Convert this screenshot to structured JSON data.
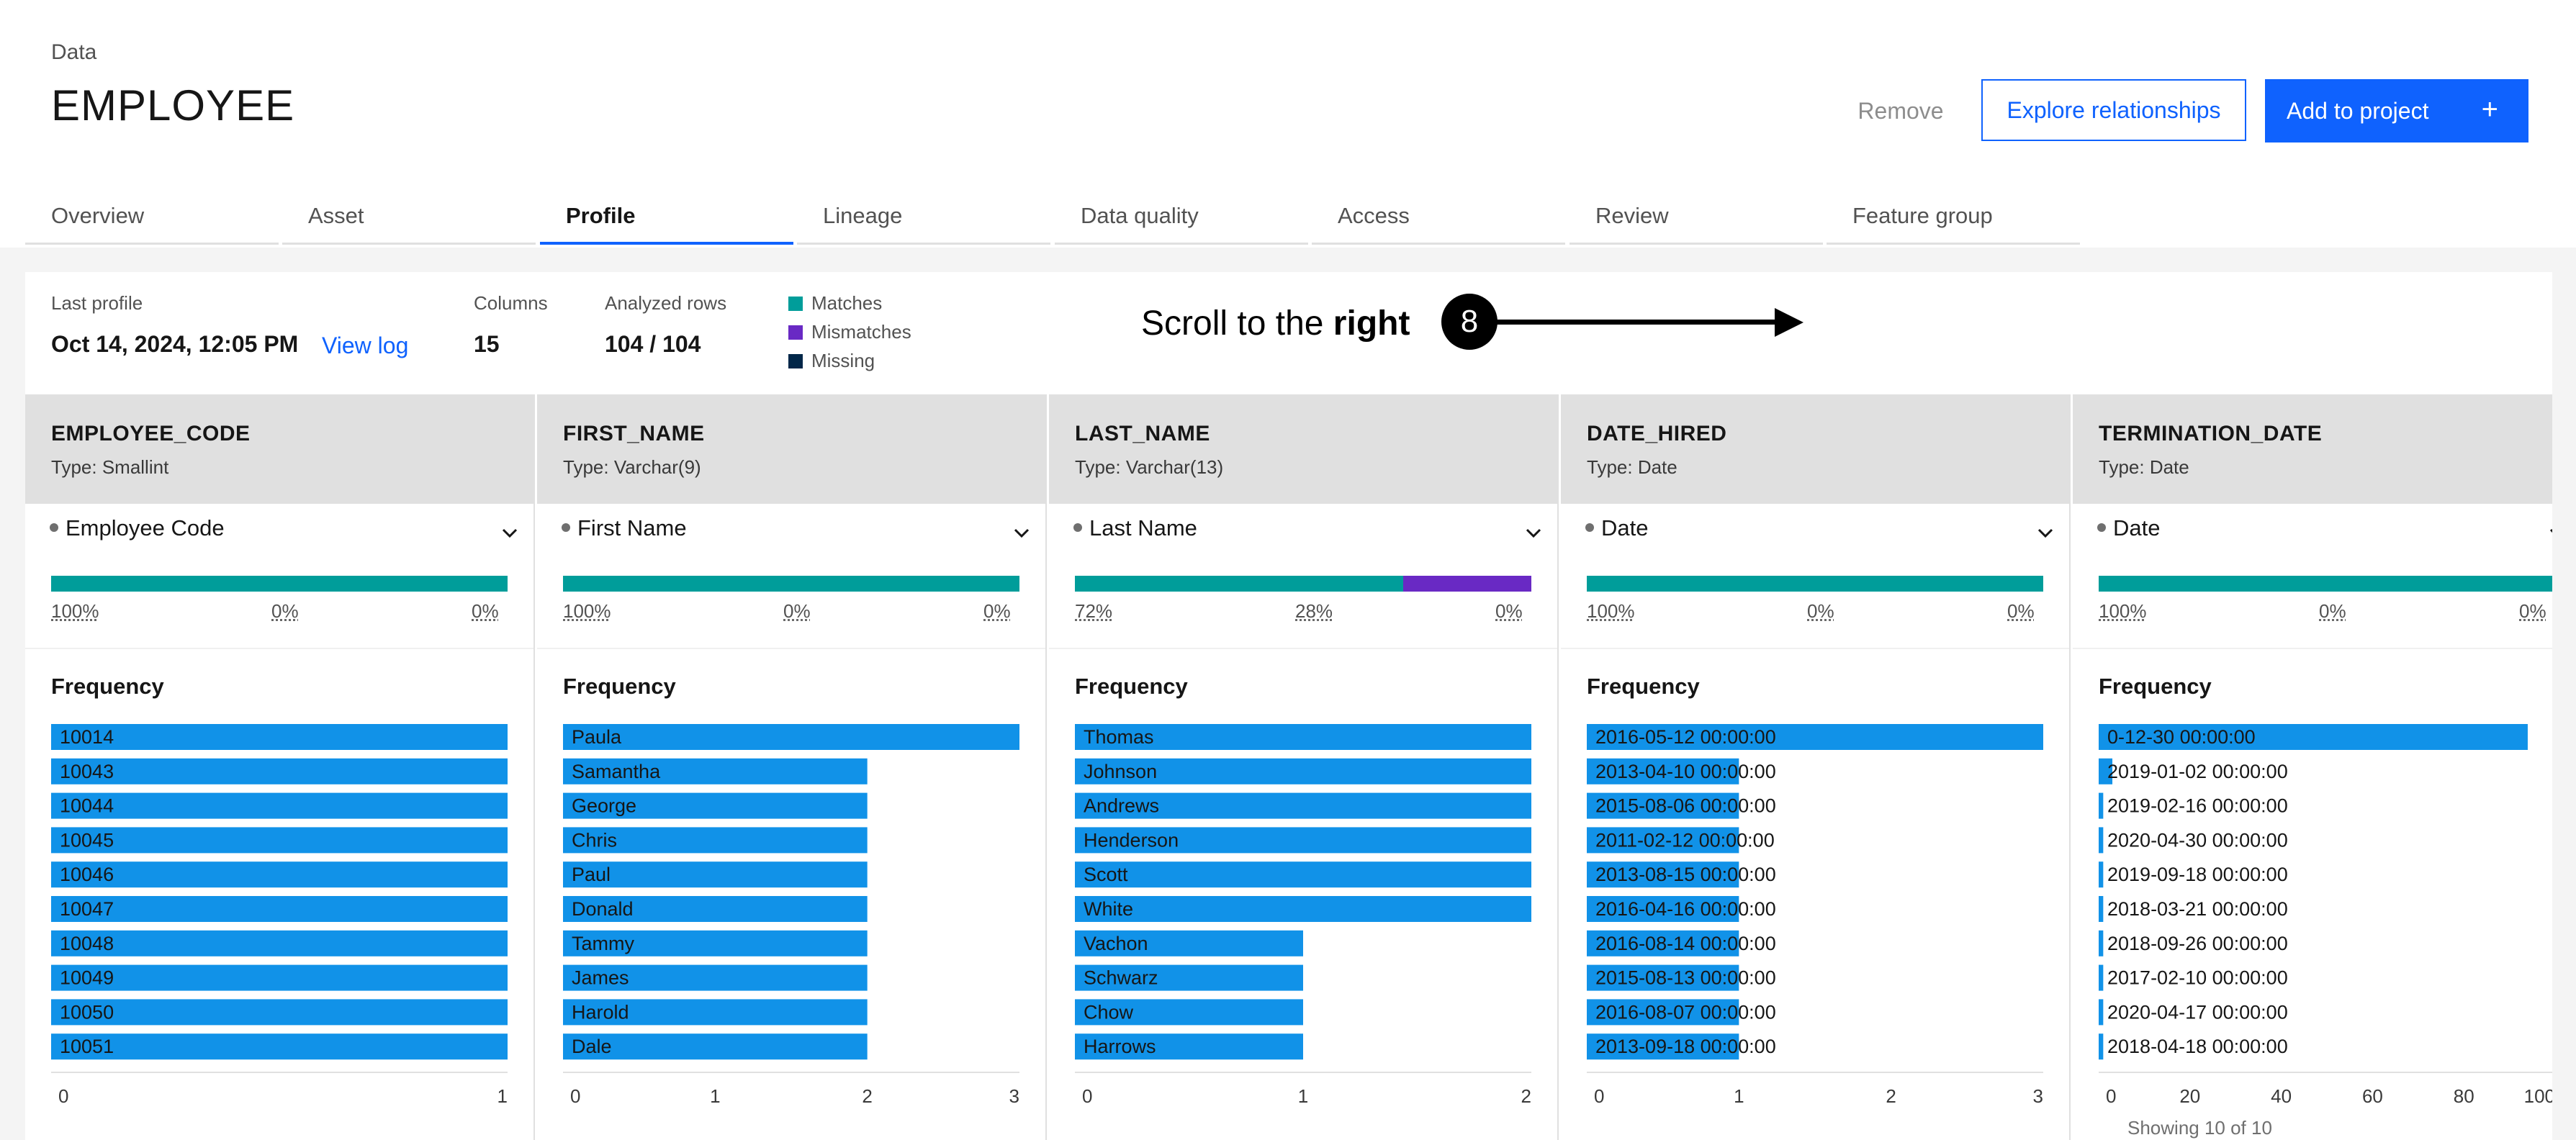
{
  "header": {
    "breadcrumb": "Data",
    "title": "EMPLOYEE",
    "remove_label": "Remove",
    "explore_label": "Explore relationships",
    "add_label": "Add to project",
    "add_icon": "+"
  },
  "tabs": [
    {
      "label": "Overview",
      "active": false
    },
    {
      "label": "Asset",
      "active": false
    },
    {
      "label": "Profile",
      "active": true
    },
    {
      "label": "Lineage",
      "active": false
    },
    {
      "label": "Data quality",
      "active": false
    },
    {
      "label": "Access",
      "active": false
    },
    {
      "label": "Review",
      "active": false
    },
    {
      "label": "Feature group",
      "active": false
    }
  ],
  "summary": {
    "last_profile_label": "Last profile",
    "last_profile_value": "Oct 14, 2024, 12:05 PM",
    "view_log": "View log",
    "columns_label": "Columns",
    "columns_value": "15",
    "rows_label": "Analyzed rows",
    "rows_value": "104 / 104",
    "legend": [
      {
        "label": "Matches",
        "color": "#009d9a"
      },
      {
        "label": "Mismatches",
        "color": "#6929c4"
      },
      {
        "label": "Missing",
        "color": "#012749"
      }
    ]
  },
  "annotation": {
    "text_prefix": "Scroll to the ",
    "text_bold": "right",
    "step": "8"
  },
  "colors": {
    "accent": "#0f62fe",
    "bar": "#1192e8",
    "match": "#009d9a",
    "mismatch": "#6929c4"
  },
  "frequency_title": "Frequency",
  "showing": "Showing 10 of 10",
  "columns": [
    {
      "name": "EMPLOYEE_CODE",
      "type": "Type: Smallint",
      "classification": "Employee Code",
      "quality": {
        "match": 100,
        "mismatch": 0,
        "missing": 0,
        "labels": [
          "100%",
          "0%",
          "0%"
        ]
      },
      "chart_data": {
        "type": "bar",
        "categories": [
          "10014",
          "10043",
          "10044",
          "10045",
          "10046",
          "10047",
          "10048",
          "10049",
          "10050",
          "10051"
        ],
        "values": [
          1,
          1,
          1,
          1,
          1,
          1,
          1,
          1,
          1,
          1
        ],
        "xlim": [
          0,
          1
        ],
        "xticks": [
          "0",
          "1"
        ]
      }
    },
    {
      "name": "FIRST_NAME",
      "type": "Type: Varchar(9)",
      "classification": "First Name",
      "quality": {
        "match": 100,
        "mismatch": 0,
        "missing": 0,
        "labels": [
          "100%",
          "0%",
          "0%"
        ]
      },
      "chart_data": {
        "type": "bar",
        "categories": [
          "Paula",
          "Samantha",
          "George",
          "Chris",
          "Paul",
          "Donald",
          "Tammy",
          "James",
          "Harold",
          "Dale"
        ],
        "values": [
          3,
          2,
          2,
          2,
          2,
          2,
          2,
          2,
          2,
          2
        ],
        "xlim": [
          0,
          3
        ],
        "xticks": [
          "0",
          "1",
          "2",
          "3"
        ]
      }
    },
    {
      "name": "LAST_NAME",
      "type": "Type: Varchar(13)",
      "classification": "Last Name",
      "quality": {
        "match": 72,
        "mismatch": 28,
        "missing": 0,
        "labels": [
          "72%",
          "28%",
          "0%"
        ]
      },
      "chart_data": {
        "type": "bar",
        "categories": [
          "Thomas",
          "Johnson",
          "Andrews",
          "Henderson",
          "Scott",
          "White",
          "Vachon",
          "Schwarz",
          "Chow",
          "Harrows"
        ],
        "values": [
          2,
          2,
          2,
          2,
          2,
          2,
          1,
          1,
          1,
          1
        ],
        "xlim": [
          0,
          2
        ],
        "xticks": [
          "0",
          "1",
          "2"
        ]
      }
    },
    {
      "name": "DATE_HIRED",
      "type": "Type: Date",
      "classification": "Date",
      "quality": {
        "match": 100,
        "mismatch": 0,
        "missing": 0,
        "labels": [
          "100%",
          "0%",
          "0%"
        ]
      },
      "chart_data": {
        "type": "bar",
        "categories": [
          "2016-05-12 00:00:00",
          "2013-04-10 00:00:00",
          "2015-08-06 00:00:00",
          "2011-02-12 00:00:00",
          "2013-08-15 00:00:00",
          "2016-04-16 00:00:00",
          "2016-08-14 00:00:00",
          "2015-08-13 00:00:00",
          "2016-08-07 00:00:00",
          "2013-09-18 00:00:00"
        ],
        "values": [
          3,
          1,
          1,
          1,
          1,
          1,
          1,
          1,
          1,
          1
        ],
        "xlim": [
          0,
          3
        ],
        "xticks": [
          "0",
          "1",
          "2",
          "3"
        ]
      }
    },
    {
      "name": "TERMINATION_DATE",
      "type": "Type: Date",
      "classification": "Date",
      "quality": {
        "match": 100,
        "mismatch": 0,
        "missing": 0,
        "labels": [
          "100%",
          "0%",
          "0%"
        ]
      },
      "chart_data": {
        "type": "bar",
        "categories": [
          "0-12-30 00:00:00",
          "2019-01-02 00:00:00",
          "2019-02-16 00:00:00",
          "2020-04-30 00:00:00",
          "2019-09-18 00:00:00",
          "2018-03-21 00:00:00",
          "2018-09-26 00:00:00",
          "2017-02-10 00:00:00",
          "2020-04-17 00:00:00",
          "2018-04-18 00:00:00"
        ],
        "values": [
          94,
          3,
          1,
          1,
          1,
          1,
          1,
          1,
          1,
          1
        ],
        "xlim": [
          0,
          100
        ],
        "xticks": [
          "0",
          "20",
          "40",
          "60",
          "80",
          "100"
        ]
      }
    }
  ]
}
